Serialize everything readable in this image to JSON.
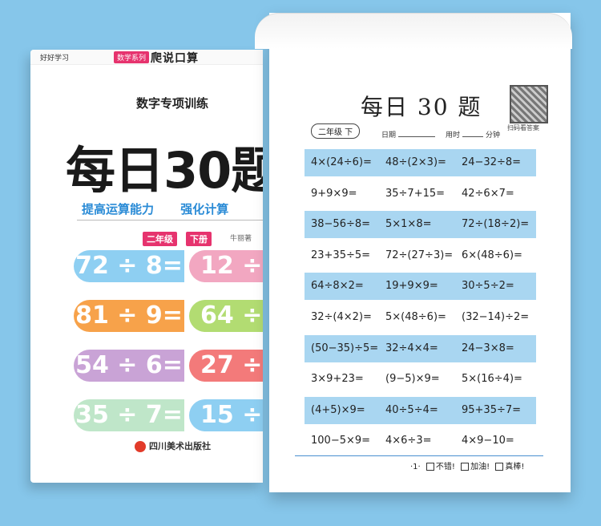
{
  "cover": {
    "brand": "好好学习",
    "series_badge": "数学系列",
    "title_small": "爬说口算",
    "subtitle": "数字专项训练",
    "big_title": "每日30题",
    "slogans": [
      "提高运算能力",
      "强化计算"
    ],
    "grade": "二年级",
    "term": "下册",
    "author": "牛丽著",
    "pills_left": [
      "72 ÷ 8=",
      "81 ÷ 9=",
      "54 ÷ 6=",
      "35 ÷ 7="
    ],
    "pills_right": [
      "12 ÷",
      "64 ÷",
      "27 ÷",
      "15 ÷"
    ],
    "pill_colors_left": [
      "#8ecff2",
      "#f7a24a",
      "#c9a3d6",
      "#bfe6c9"
    ],
    "pill_colors_right": [
      "#f2a7c1",
      "#b2dc72",
      "#f37a7a",
      "#8ecff2"
    ],
    "publisher": "四川美术出版社"
  },
  "sheet": {
    "title": "每日 30 题",
    "qr_caption": "扫码看答案",
    "grade_label": "二年级 下",
    "date_label": "日期",
    "time_label": "用时",
    "time_unit": "分钟",
    "rows": [
      [
        "4×(24÷6)=",
        "48÷(2×3)=",
        "24−32÷8="
      ],
      [
        "9+9×9=",
        "35÷7+15=",
        "42÷6×7="
      ],
      [
        "38−56÷8=",
        "5×1×8=",
        "72÷(18÷2)="
      ],
      [
        "23+35÷5=",
        "72÷(27÷3)=",
        "6×(48÷6)="
      ],
      [
        "64÷8×2=",
        "19+9×9=",
        "30÷5÷2="
      ],
      [
        "32÷(4×2)=",
        "5×(48÷6)=",
        "(32−14)÷2="
      ],
      [
        "(50−35)÷5=",
        "32÷4×4=",
        "24−3×8="
      ],
      [
        "3×9+23=",
        "(9−5)×9=",
        "5×(16÷4)="
      ],
      [
        "(4+5)×9=",
        "40÷5÷4=",
        "95+35÷7="
      ],
      [
        "100−5×9=",
        "4×6÷3=",
        "4×9−10="
      ]
    ],
    "page_number": "·1·",
    "rating": [
      "不错!",
      "加油!",
      "真棒!"
    ]
  }
}
